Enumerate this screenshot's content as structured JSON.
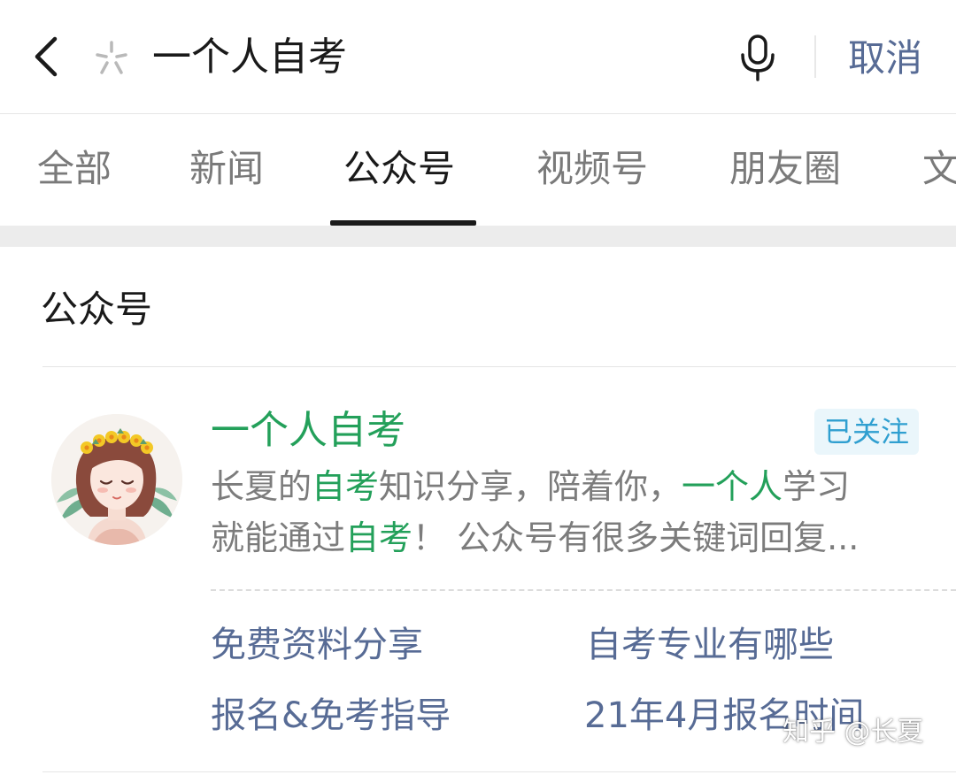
{
  "search": {
    "query": "一个人自考",
    "cancel_label": "取消",
    "icons": {
      "back": "chevron-left-icon",
      "brand": "spark-icon",
      "mic": "microphone-icon"
    }
  },
  "tabs": [
    {
      "label": "全部",
      "active": false
    },
    {
      "label": "新闻",
      "active": false
    },
    {
      "label": "公众号",
      "active": true
    },
    {
      "label": "视频号",
      "active": false
    },
    {
      "label": "朋友圈",
      "active": false
    },
    {
      "label": "文",
      "active": false
    }
  ],
  "section": {
    "title": "公众号"
  },
  "account": {
    "name": "一个人自考",
    "follow_status": "已关注",
    "desc_line1": [
      "长夏的",
      "自考",
      "知识分享，陪着你，",
      "一个人",
      "学习"
    ],
    "desc_line2": [
      "就能通过",
      "自考",
      "！ 公众号有很多关键词回复..."
    ],
    "menu": [
      "免费资料分享",
      "自考专业有哪些",
      "报名&免考指导",
      "21年4月报名时间"
    ]
  },
  "watermark": "知乎 @长夏",
  "colors": {
    "highlight": "#23a05a",
    "link": "#576b95",
    "follow_badge_bg": "#eaf6fb",
    "follow_badge_text": "#2f9fd0",
    "muted_text": "#7c7c7c"
  }
}
